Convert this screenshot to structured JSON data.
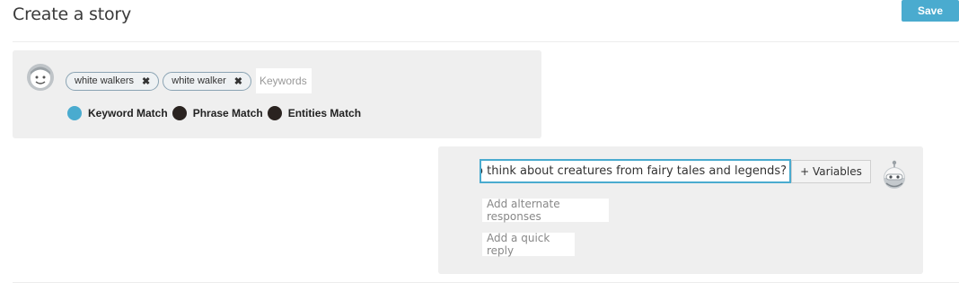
{
  "header": {
    "title": "Create a story",
    "save_label": "Save"
  },
  "user_panel": {
    "avatar_icon": "user-face-icon",
    "tags": [
      {
        "label": "white walkers",
        "remove_icon": "close-icon"
      },
      {
        "label": "white walker",
        "remove_icon": "close-icon"
      }
    ],
    "keywords_placeholder": "Keywords",
    "match_options": [
      {
        "label": "Keyword Match",
        "selected": true
      },
      {
        "label": "Phrase Match",
        "selected": false
      },
      {
        "label": "Entities Match",
        "selected": false
      }
    ]
  },
  "bot_panel": {
    "avatar_icon": "robot-icon",
    "response_value": "to think about creatures from fairy tales and legends?",
    "variables_label": "+ Variables",
    "alternate_label": "Add alternate responses",
    "quick_reply_label": "Add a quick reply"
  },
  "colors": {
    "accent": "#4aabcf",
    "panel_bg": "#efefef",
    "radio_off": "#2a2320"
  }
}
